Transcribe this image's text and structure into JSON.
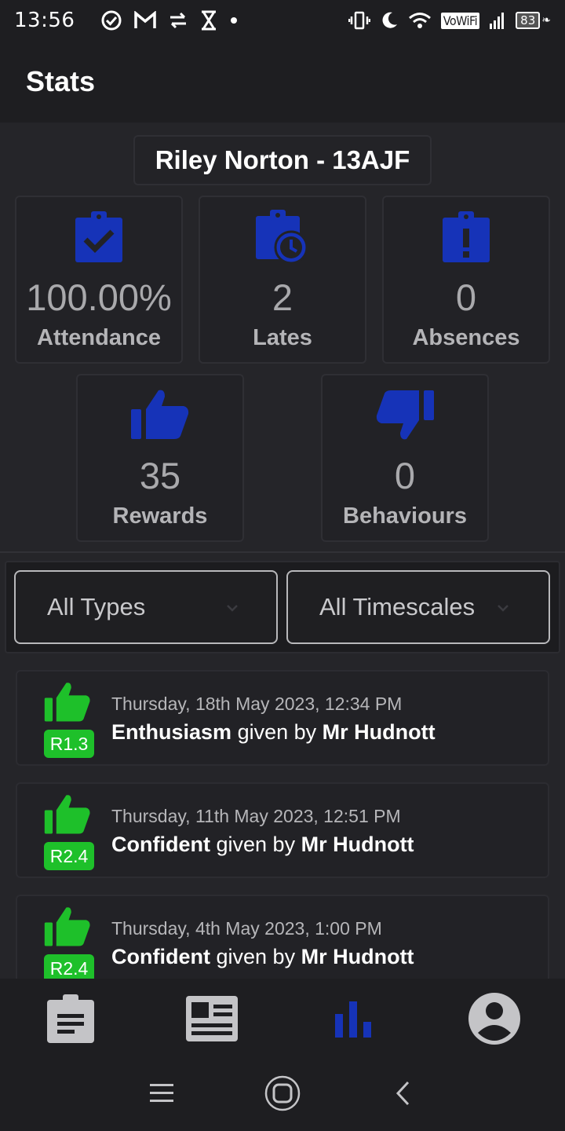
{
  "status_bar": {
    "time": "13:56",
    "wifi_label": "VoWiFi",
    "battery": "83"
  },
  "app_bar": {
    "title": "Stats"
  },
  "student": {
    "name": "Riley Norton - 13AJF"
  },
  "stats": {
    "attendance": {
      "value": "100.00%",
      "label": "Attendance",
      "icon": "clipboard-check-icon"
    },
    "lates": {
      "value": "2",
      "label": "Lates",
      "icon": "clipboard-clock-icon"
    },
    "absences": {
      "value": "0",
      "label": "Absences",
      "icon": "clipboard-alert-icon"
    },
    "rewards": {
      "value": "35",
      "label": "Rewards",
      "icon": "thumbs-up-icon"
    },
    "behaviours": {
      "value": "0",
      "label": "Behaviours",
      "icon": "thumbs-down-icon"
    }
  },
  "filters": {
    "type": "All Types",
    "timescale": "All Timescales"
  },
  "entries": [
    {
      "date": "Thursday, 18th May 2023, 12:34 PM",
      "badge": "R1.3",
      "reason": "Enthusiasm",
      "given_by": "given by",
      "teacher": "Mr Hudnott"
    },
    {
      "date": "Thursday, 11th May 2023, 12:51 PM",
      "badge": "R2.4",
      "reason": "Confident",
      "given_by": "given by",
      "teacher": "Mr Hudnott"
    },
    {
      "date": "Thursday, 4th May 2023, 1:00 PM",
      "badge": "R2.4",
      "reason": "Confident",
      "given_by": "given by",
      "teacher": "Mr Hudnott"
    }
  ],
  "colors": {
    "accent_blue": "#1633b8",
    "reward_green": "#1ec02a",
    "background": "#252529"
  },
  "bottom_nav": [
    "clipboard-icon",
    "newspaper-icon",
    "bar-chart-icon",
    "account-icon"
  ],
  "active_nav": "bar-chart-icon"
}
